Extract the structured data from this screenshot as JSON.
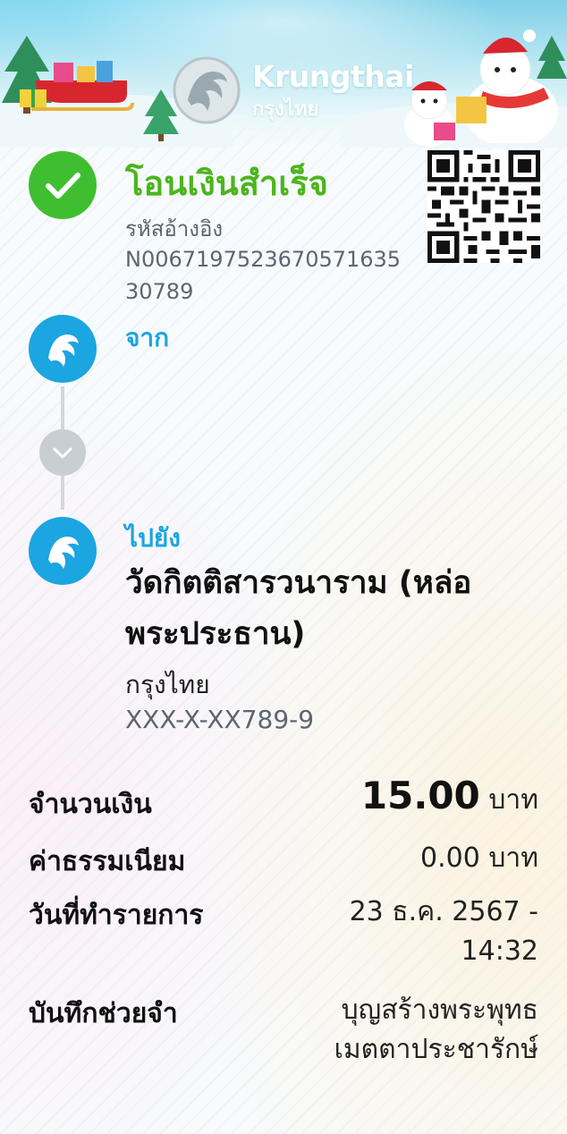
{
  "header": {
    "brand_en": "Krungthai",
    "brand_th": "กรุงไทย"
  },
  "status": {
    "title": "โอนเงินสำเร็จ",
    "ref_label": "รหัสอ้างอิง",
    "ref_value": "N006719752367057163530789"
  },
  "from": {
    "label": "จาก"
  },
  "to": {
    "label": "ไปยัง",
    "name": "วัดกิตติสารวนาราม (หล่อพระประธาน)",
    "bank": "กรุงไทย",
    "account": "XXX-X-XX789-9"
  },
  "details": {
    "amount_label": "จำนวนเงิน",
    "amount_value": "15.00",
    "amount_unit": "บาท",
    "fee_label": "ค่าธรรมเนียม",
    "fee_value": "0.00 บาท",
    "date_label": "วันที่ทำรายการ",
    "date_value": "23 ธ.ค. 2567 -",
    "time_value": "14:32",
    "memo_label": "บันทึกช่วยจำ",
    "memo_line1": "บุญสร้างพระพุทธ",
    "memo_line2": "เมตตาประชารักษ์"
  },
  "colors": {
    "success_green": "#4cb51c",
    "krungthai_blue": "#1ba5e1",
    "timeline_grey": "#c9ced3"
  },
  "icons": {
    "status": "check-icon",
    "bank": "krungthai-logo-icon",
    "flow": "chevron-down-icon"
  }
}
